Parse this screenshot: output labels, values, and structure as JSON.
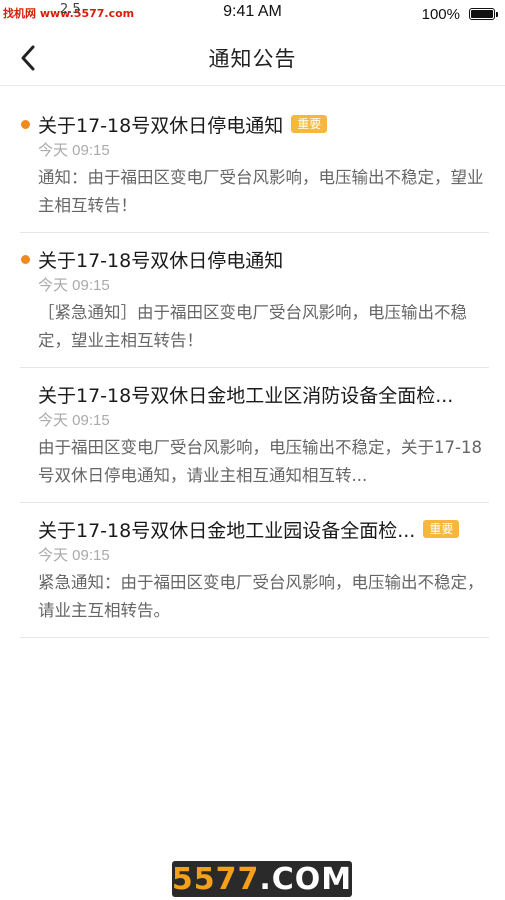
{
  "status_bar": {
    "watermark": "找机网 www.5577.com",
    "time": "9:41 AM",
    "battery": "100%",
    "carrier_fragment": "2.5"
  },
  "nav": {
    "title": "通知公告",
    "back_icon": "chevron-left-icon"
  },
  "notices": [
    {
      "title": "关于17-18号双休日停电通知",
      "badge": "重要",
      "time": "今天 09:15",
      "body": "通知：由于福田区变电厂受台风影响，电压输出不稳定，望业主相互转告！",
      "unread": true
    },
    {
      "title": "关于17-18号双休日停电通知",
      "badge": "",
      "time": "今天 09:15",
      "body": "［紧急通知］由于福田区变电厂受台风影响，电压输出不稳定，望业主相互转告！",
      "unread": true
    },
    {
      "title": "关于17-18号双休日金地工业区消防设备全面检...",
      "badge": "",
      "time": "今天 09:15",
      "body": "由于福田区变电厂受台风影响，电压输出不稳定，关于17-18号双休日停电通知，请业主相互通知相互转...",
      "unread": false
    },
    {
      "title": "关于17-18号双休日金地工业园设备全面检...",
      "badge": "重要",
      "time": "今天 09:15",
      "body": "紧急通知：由于福田区变电厂受台风影响，电压输出不稳定，请业主互相转告。",
      "unread": false
    }
  ],
  "bottom_watermark": {
    "number": "5577",
    "domain": ".COM"
  },
  "colors": {
    "unread_dot": "#f08a1f",
    "badge": "#f6b73c"
  }
}
